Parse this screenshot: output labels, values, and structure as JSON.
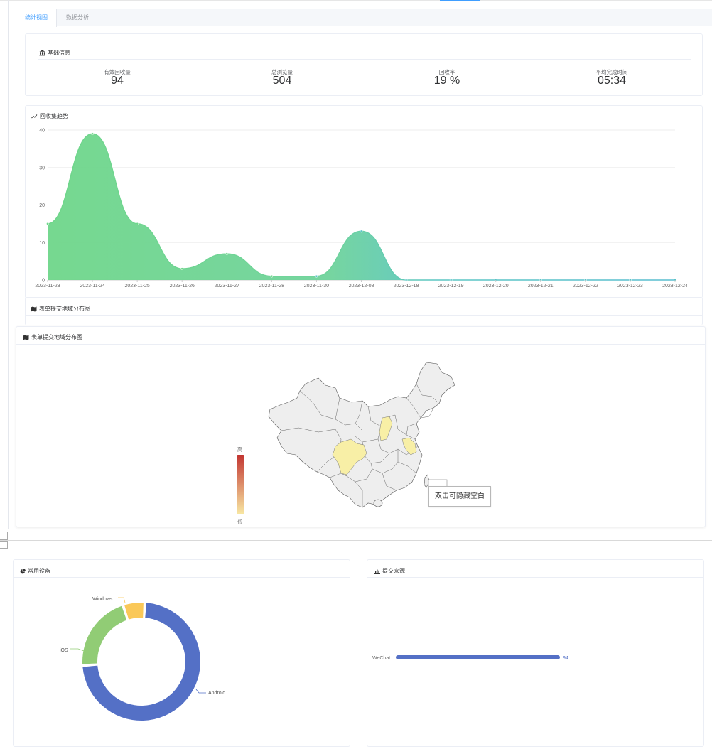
{
  "tabs": [
    {
      "label": "统计视图",
      "active": true
    },
    {
      "label": "数据分析",
      "active": false
    }
  ],
  "basic_info": {
    "title": "基础信息",
    "stats": [
      {
        "label": "有效回收量",
        "value": "94"
      },
      {
        "label": "总浏览量",
        "value": "504"
      },
      {
        "label": "回收率",
        "value": "19 %"
      },
      {
        "label": "平均完成时间",
        "value": "05:34"
      }
    ]
  },
  "trend": {
    "title": "回收集趋势"
  },
  "map_peek_title": "表单提交地域分布图",
  "map": {
    "title": "表单提交地域分布图",
    "legend_high": "高",
    "legend_low": "低",
    "tooltip": "双击可隐藏空白",
    "legend_colors": [
      "#c23531",
      "#f8e8a3"
    ],
    "highlighted_provinces": [
      "四川",
      "山西",
      "江苏"
    ]
  },
  "devices": {
    "title": "常用设备",
    "labels": {
      "windows": "Windows",
      "ios": "iOS",
      "android": "Android"
    }
  },
  "sources": {
    "title": "提交来源",
    "label": "WeChat",
    "value_label": "94"
  },
  "chart_data": [
    {
      "type": "area",
      "title": "回收集趋势",
      "x": [
        "2023-11-23",
        "2023-11-24",
        "2023-11-25",
        "2023-11-26",
        "2023-11-27",
        "2023-11-28",
        "2023-11-30",
        "2023-12-08",
        "2023-12-18",
        "2023-12-19",
        "2023-12-20",
        "2023-12-21",
        "2023-12-22",
        "2023-12-23",
        "2023-12-24"
      ],
      "values": [
        15,
        39,
        15,
        3,
        7,
        1,
        1,
        13,
        0,
        0,
        0,
        0,
        0,
        0,
        0
      ],
      "y_ticks": [
        0,
        10,
        20,
        30,
        40
      ],
      "ylim": [
        0,
        40
      ],
      "smooth": true,
      "colors": [
        "#6dd387",
        "#5bc4c8"
      ],
      "grid": true
    },
    {
      "type": "pie",
      "donut": true,
      "slices": [
        {
          "name": "Android",
          "value": 73,
          "color": "#5470c6"
        },
        {
          "name": "iOS",
          "value": 21,
          "color": "#91cc75"
        },
        {
          "name": "Windows",
          "value": 6,
          "color": "#fac858"
        }
      ]
    },
    {
      "type": "bar",
      "orientation": "horizontal",
      "categories": [
        "WeChat"
      ],
      "values": [
        94
      ],
      "color": "#5470c6"
    }
  ]
}
